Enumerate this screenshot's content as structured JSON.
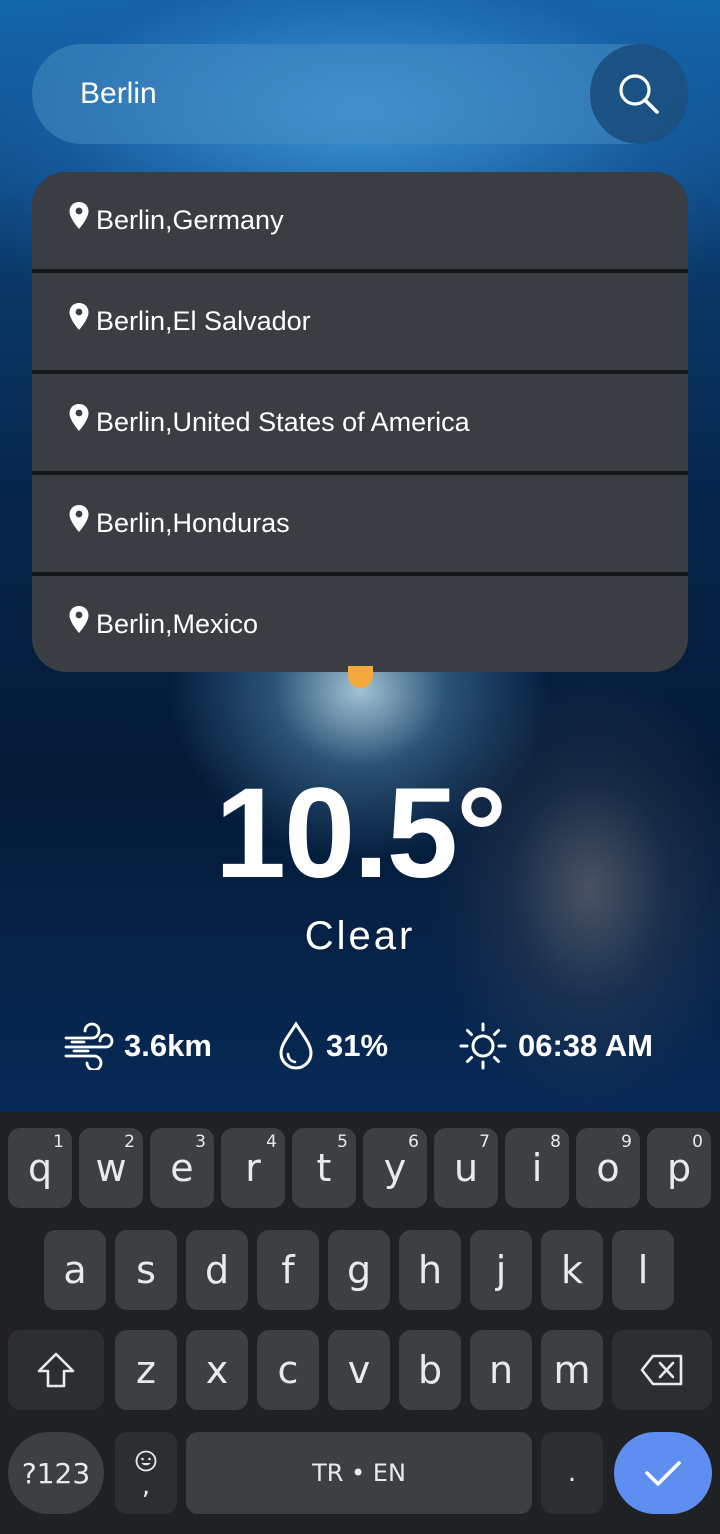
{
  "search": {
    "value": "Berlin",
    "button_icon": "search-icon"
  },
  "suggestions": [
    {
      "label": "Berlin,Germany"
    },
    {
      "label": "Berlin,El Salvador"
    },
    {
      "label": "Berlin,United States of America"
    },
    {
      "label": "Berlin,Honduras"
    },
    {
      "label": "Berlin,Mexico"
    }
  ],
  "weather": {
    "temperature": "10.5°",
    "condition": "Clear",
    "wind": "3.6km",
    "humidity": "31%",
    "sunrise": "06:38 AM"
  },
  "keyboard": {
    "row1": [
      {
        "key": "q",
        "hint": "1"
      },
      {
        "key": "w",
        "hint": "2"
      },
      {
        "key": "e",
        "hint": "3"
      },
      {
        "key": "r",
        "hint": "4"
      },
      {
        "key": "t",
        "hint": "5"
      },
      {
        "key": "y",
        "hint": "6"
      },
      {
        "key": "u",
        "hint": "7"
      },
      {
        "key": "i",
        "hint": "8"
      },
      {
        "key": "o",
        "hint": "9"
      },
      {
        "key": "p",
        "hint": "0"
      }
    ],
    "row2": [
      "a",
      "s",
      "d",
      "f",
      "g",
      "h",
      "j",
      "k",
      "l"
    ],
    "row3": [
      "z",
      "x",
      "c",
      "v",
      "b",
      "n",
      "m"
    ],
    "symbols_label": "?123",
    "comma_label": ",",
    "space_label": "TR • EN",
    "period_label": "."
  },
  "colors": {
    "accent": "#5d8ef0",
    "sun": "#f4a93c",
    "card": "#3a3d42"
  }
}
